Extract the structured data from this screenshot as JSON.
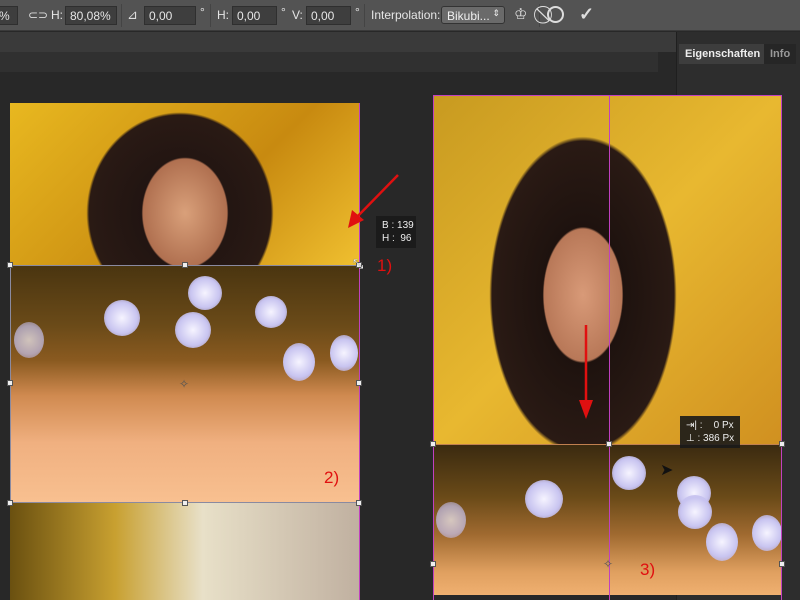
{
  "toolbar": {
    "w_partial": "%",
    "h_label": "H:",
    "h_value": "80,08%",
    "angle_value": "0,00",
    "deg": "°",
    "skew_h_label": "H:",
    "skew_h_value": "0,00",
    "skew_v_label": "V:",
    "skew_v_value": "0,00",
    "interpolation_label": "Interpolation:",
    "interpolation_value": "Bikubi..."
  },
  "panel": {
    "tabs": [
      "Eigenschaften",
      "Info"
    ]
  },
  "tooltips": {
    "left": "B : 139\nH :  96",
    "right": "⇥| :    0 Px\n⊥ : 386 Px"
  },
  "annotations": [
    "1)",
    "2)",
    "3)"
  ]
}
